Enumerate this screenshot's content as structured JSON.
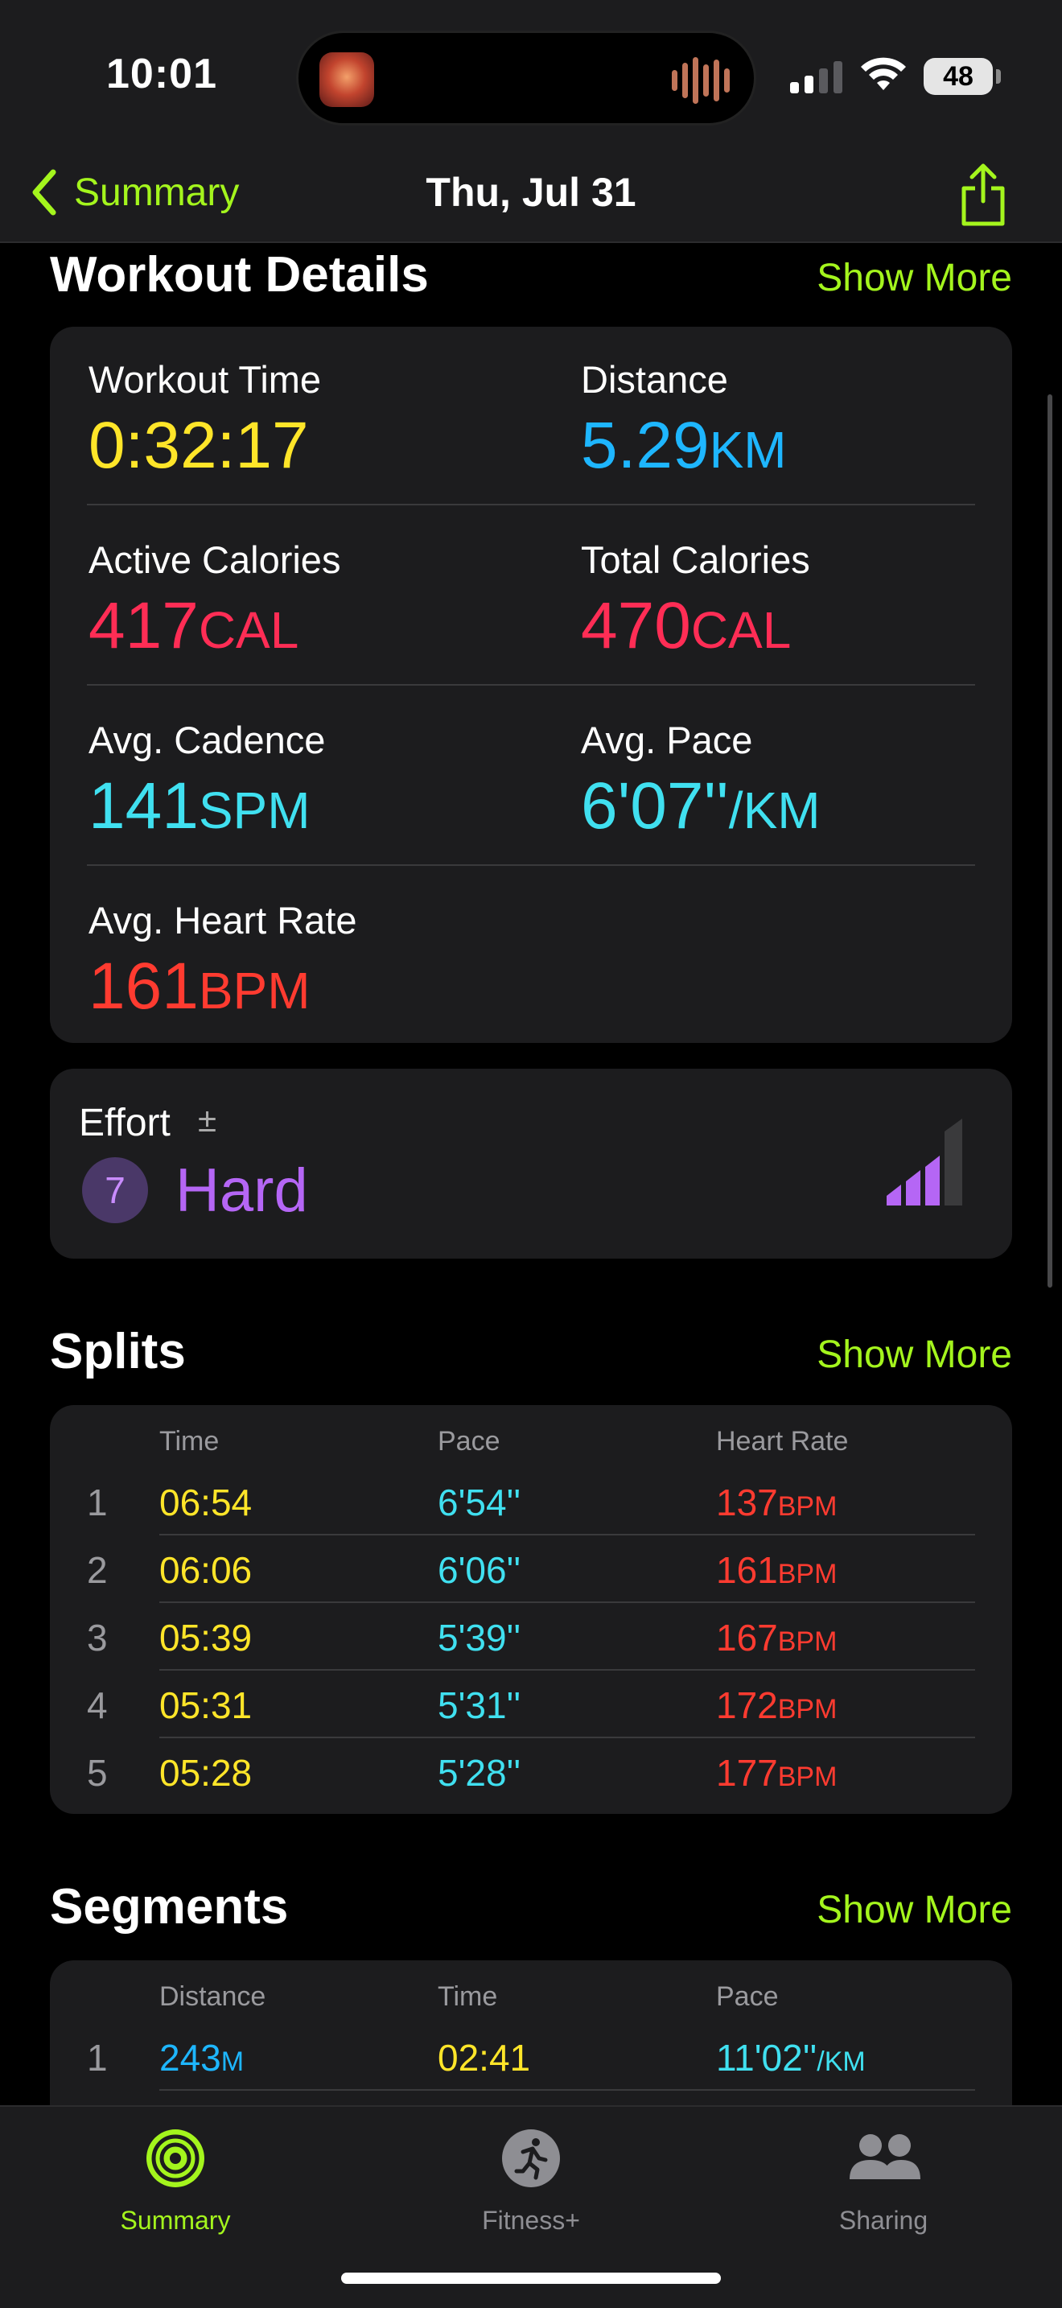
{
  "status_bar": {
    "time": "10:01",
    "battery": "48"
  },
  "nav": {
    "back_label": "Summary",
    "title": "Thu, Jul 31"
  },
  "colors": {
    "accent": "#a4f51d",
    "yellow": "#ffe529",
    "blue": "#1eb6ff",
    "pink": "#ff2d55",
    "cyan": "#40e0f0",
    "red": "#ff3b30",
    "purple": "#b566f5"
  },
  "workout_details": {
    "title": "Workout Details",
    "show_more": "Show More",
    "workout_time": {
      "label": "Workout Time",
      "value": "0:32:17"
    },
    "distance": {
      "label": "Distance",
      "value": "5.29",
      "unit": "KM"
    },
    "active_calories": {
      "label": "Active Calories",
      "value": "417",
      "unit": "CAL"
    },
    "total_calories": {
      "label": "Total Calories",
      "value": "470",
      "unit": "CAL"
    },
    "avg_cadence": {
      "label": "Avg. Cadence",
      "value": "141",
      "unit": "SPM"
    },
    "avg_pace": {
      "label": "Avg. Pace",
      "value": "6'07''",
      "unit": "/KM"
    },
    "avg_heart_rate": {
      "label": "Avg. Heart Rate",
      "value": "161",
      "unit": "BPM"
    }
  },
  "effort": {
    "label": "Effort",
    "modifier": "±",
    "level": "7",
    "level_name": "Hard",
    "bars_filled": 3,
    "bars_total": 4
  },
  "splits": {
    "title": "Splits",
    "show_more": "Show More",
    "headers": [
      "Time",
      "Pace",
      "Heart Rate"
    ],
    "rows": [
      {
        "n": "1",
        "time": "06:54",
        "pace": "6'54''",
        "hr": "137",
        "hr_unit": "BPM"
      },
      {
        "n": "2",
        "time": "06:06",
        "pace": "6'06''",
        "hr": "161",
        "hr_unit": "BPM"
      },
      {
        "n": "3",
        "time": "05:39",
        "pace": "5'39''",
        "hr": "167",
        "hr_unit": "BPM"
      },
      {
        "n": "4",
        "time": "05:31",
        "pace": "5'31''",
        "hr": "172",
        "hr_unit": "BPM"
      },
      {
        "n": "5",
        "time": "05:28",
        "pace": "5'28''",
        "hr": "177",
        "hr_unit": "BPM"
      }
    ]
  },
  "segments": {
    "title": "Segments",
    "show_more": "Show More",
    "headers": [
      "Distance",
      "Time",
      "Pace"
    ],
    "rows": [
      {
        "n": "1",
        "distance": "243",
        "distance_unit": "M",
        "time": "02:41",
        "pace": "11'02''",
        "pace_unit": "/KM"
      }
    ]
  },
  "tabs": [
    {
      "label": "Summary",
      "icon": "activity-rings-icon",
      "active": true
    },
    {
      "label": "Fitness+",
      "icon": "runner-icon",
      "active": false
    },
    {
      "label": "Sharing",
      "icon": "people-icon",
      "active": false
    }
  ]
}
